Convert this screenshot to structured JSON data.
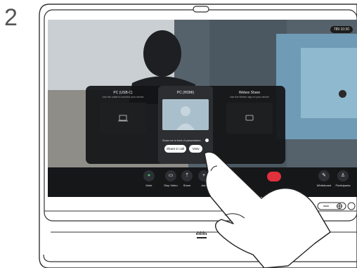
{
  "step": "2",
  "screen": {
    "call_timer": "789 10:30"
  },
  "share_panel": {
    "sources": [
      {
        "title": "PC (USB-C)",
        "subtitle": "Use the cable to connect your device"
      },
      {
        "title": "PC (HDMI)",
        "subtitle": ""
      },
      {
        "title": "Webex Share",
        "subtitle": "Use the Webex app on your device"
      }
    ],
    "toggle_label": "Show me in front of presentation",
    "share_in_call_label": "Share in call",
    "view_label": "View"
  },
  "controls": [
    {
      "label": "Mute",
      "icon": "microphone-icon"
    },
    {
      "label": "Stop Video",
      "icon": "camera-icon"
    },
    {
      "label": "Share",
      "icon": "share-icon"
    },
    {
      "label": "Add",
      "icon": "plus-icon"
    },
    {
      "label": "Ke",
      "icon": "keypad-icon"
    }
  ],
  "right_controls": [
    {
      "label": "Whiteboard",
      "icon": "pen-icon"
    },
    {
      "label": "Participants",
      "icon": "person-icon"
    }
  ],
  "colors": {
    "end_call": "#e0313c",
    "mute_icon": "#46c26b",
    "panel_bg": "#121416"
  }
}
